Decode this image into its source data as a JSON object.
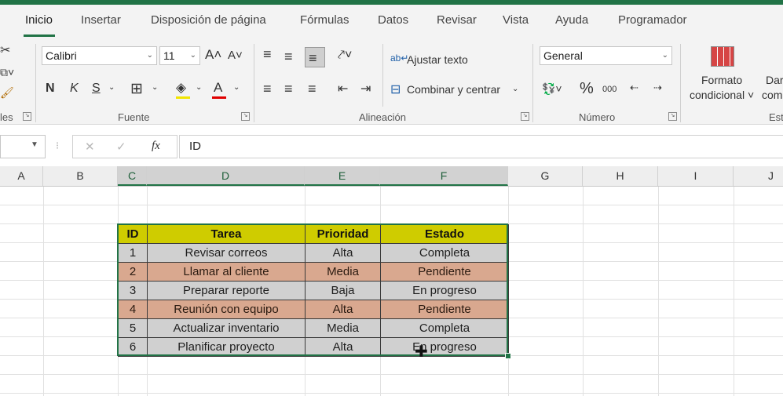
{
  "colors": {
    "accent": "#217346",
    "header_fill": "#cfcc00",
    "row_gray": "#d0d0d0",
    "row_orange": "#d9a88f"
  },
  "ribbon": {
    "tabs": [
      "Inicio",
      "Insertar",
      "Disposición de página",
      "Fórmulas",
      "Datos",
      "Revisar",
      "Vista",
      "Ayuda",
      "Programador"
    ],
    "groups": {
      "fuente": "Fuente",
      "alineacion": "Alineación",
      "numero": "Número",
      "estilos_partial": "Est",
      "left_partial": "les"
    },
    "font_name": "Calibri",
    "font_size": "11",
    "bold": "N",
    "italic": "K",
    "underline": "S",
    "grow_font": "A˄",
    "shrink_font": "A˅",
    "wrap_text": "Ajustar texto",
    "merge_center": "Combinar y centrar",
    "number_format": "General",
    "percent": "%",
    "thousands": "000",
    "cond_format_line1": "Formato",
    "cond_format_line2": "condicional ˅",
    "format_table_partial1": "Dar",
    "format_table_partial2": "com"
  },
  "formula_bar": {
    "fx": "fx",
    "content": "ID"
  },
  "columns": [
    "A",
    "B",
    "C",
    "D",
    "E",
    "F",
    "G",
    "H",
    "I",
    "J"
  ],
  "table": {
    "headers": [
      "ID",
      "Tarea",
      "Prioridad",
      "Estado"
    ],
    "rows": [
      [
        "1",
        "Revisar correos",
        "Alta",
        "Completa"
      ],
      [
        "2",
        "Llamar al cliente",
        "Media",
        "Pendiente"
      ],
      [
        "3",
        "Preparar reporte",
        "Baja",
        "En progreso"
      ],
      [
        "4",
        "Reunión con equipo",
        "Alta",
        "Pendiente"
      ],
      [
        "5",
        "Actualizar inventario",
        "Media",
        "Completa"
      ],
      [
        "6",
        "Planificar proyecto",
        "Alta",
        "En progreso"
      ]
    ]
  }
}
